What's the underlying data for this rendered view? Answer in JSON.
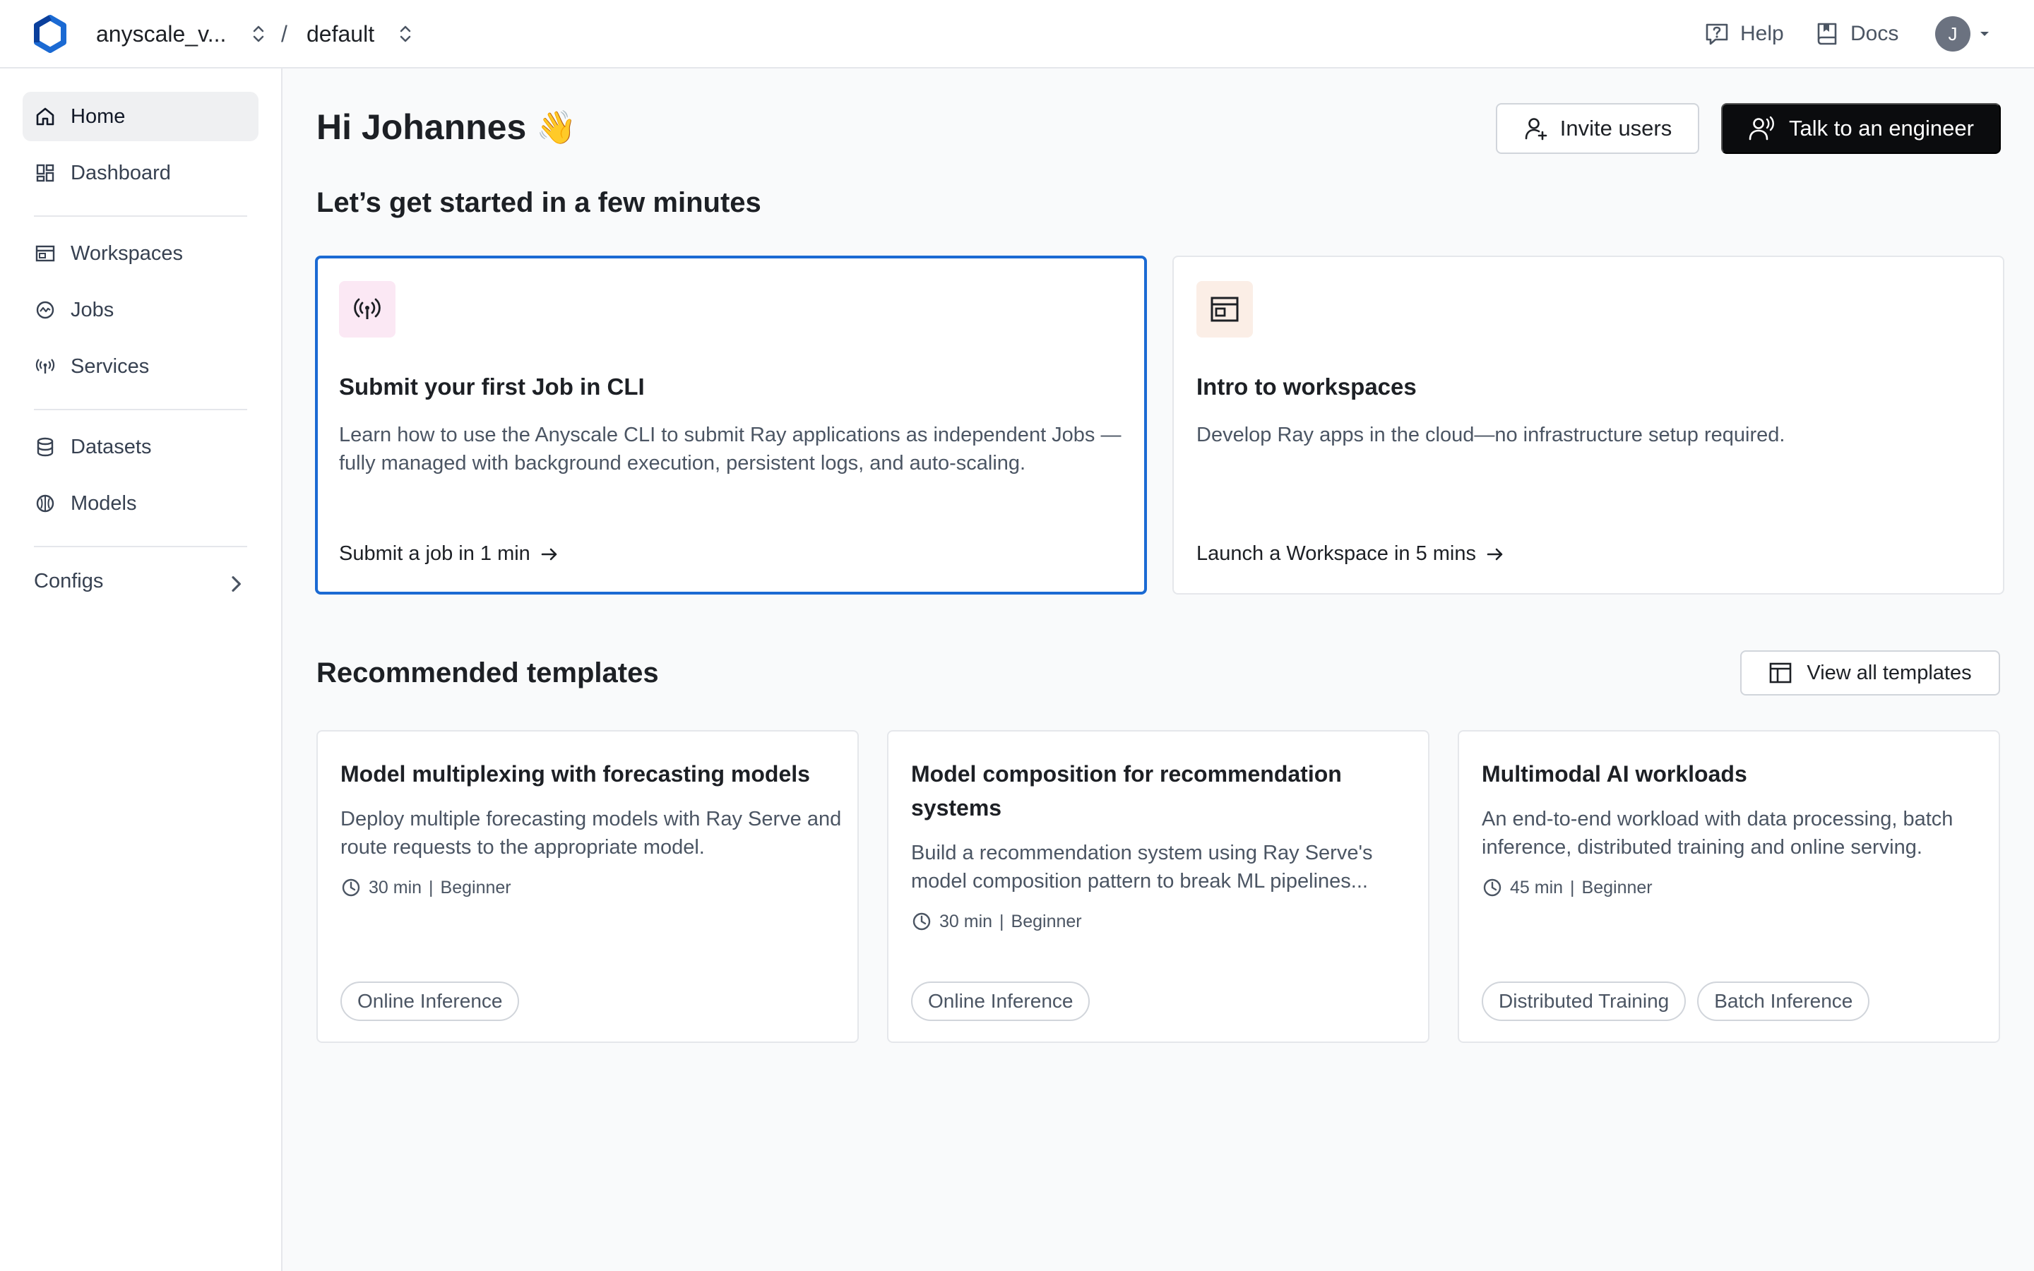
{
  "topbar": {
    "org": "anyscale_v...",
    "separator": "/",
    "project": "default",
    "help": "Help",
    "docs": "Docs",
    "avatar_initial": "J"
  },
  "sidebar": {
    "items": [
      {
        "label": "Home",
        "icon": "home-icon",
        "active": true
      },
      {
        "label": "Dashboard",
        "icon": "dashboard-icon"
      },
      {
        "label": "Workspaces",
        "icon": "workspace-icon"
      },
      {
        "label": "Jobs",
        "icon": "jobs-icon"
      },
      {
        "label": "Services",
        "icon": "services-icon"
      },
      {
        "label": "Datasets",
        "icon": "datasets-icon"
      },
      {
        "label": "Models",
        "icon": "models-icon"
      },
      {
        "label": "Configs",
        "icon": "chevron-right-icon"
      }
    ]
  },
  "main": {
    "greeting": "Hi Johannes",
    "greeting_emoji": "👋",
    "invite_button": "Invite users",
    "engineer_button": "Talk to an engineer",
    "subheading": "Let’s get started in a few minutes",
    "start_cards": [
      {
        "title": "Submit your first Job in CLI",
        "description": "Learn how to use the Anyscale CLI to submit Ray applications as independent Jobs — fully managed with background execution, persistent logs, and auto-scaling.",
        "link": "Submit a job in 1 min",
        "icon": "broadcast-icon"
      },
      {
        "title": "Intro to workspaces",
        "description": "Develop Ray apps in the cloud—no infrastructure setup required.",
        "link": "Launch a Workspace in 5 mins",
        "icon": "workspace-window-icon"
      }
    ],
    "recommended_heading": "Recommended templates",
    "view_all_button": "View all templates",
    "templates": [
      {
        "title": "Model multiplexing with forecasting models",
        "description": "Deploy multiple forecasting models with Ray Serve and route requests to the appropriate model.",
        "duration": "30 min",
        "level": "Beginner",
        "tags": [
          "Online Inference"
        ]
      },
      {
        "title": "Model composition for recommendation systems",
        "description": "Build a recommendation system using Ray Serve's model composition pattern to break ML pipelines...",
        "duration": "30 min",
        "level": "Beginner",
        "tags": [
          "Online Inference"
        ]
      },
      {
        "title": "Multimodal AI workloads",
        "description": "An end-to-end workload with data processing, batch inference, distributed training and online serving.",
        "duration": "45 min",
        "level": "Beginner",
        "tags": [
          "Distributed Training",
          "Batch Inference"
        ]
      }
    ],
    "meta_separator": "|"
  },
  "colors": {
    "accent_blue": "#1b6ad3",
    "dark_button": "#0b0c0e",
    "job_icon_bg": "#fbe8f4",
    "workspace_icon_bg": "#fbeee6"
  }
}
